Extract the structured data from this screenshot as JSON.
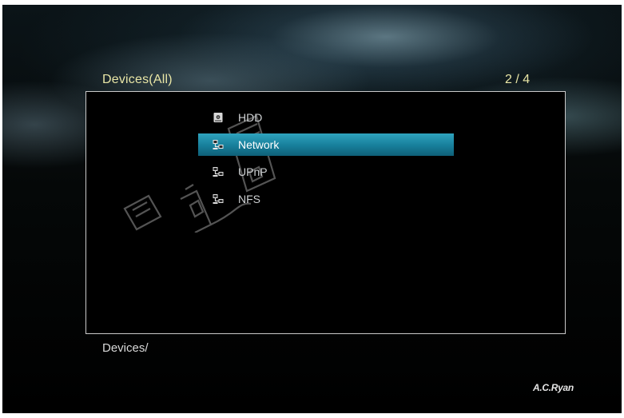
{
  "header": {
    "title": "Devices(All)",
    "page_counter": "2 / 4"
  },
  "menu": {
    "selected_index": 1,
    "items": [
      {
        "label": "HDD",
        "icon": "hdd-icon"
      },
      {
        "label": "Network",
        "icon": "network-icon"
      },
      {
        "label": "UPnP",
        "icon": "network-icon"
      },
      {
        "label": "NFS",
        "icon": "network-icon"
      }
    ]
  },
  "footer": {
    "path": "Devices/",
    "brand": "A.C.Ryan"
  },
  "colors": {
    "title_text": "#e9e6a6",
    "selection_highlight": "#1e8fad",
    "panel_border": "#c9c9c9",
    "background": "#000000"
  }
}
